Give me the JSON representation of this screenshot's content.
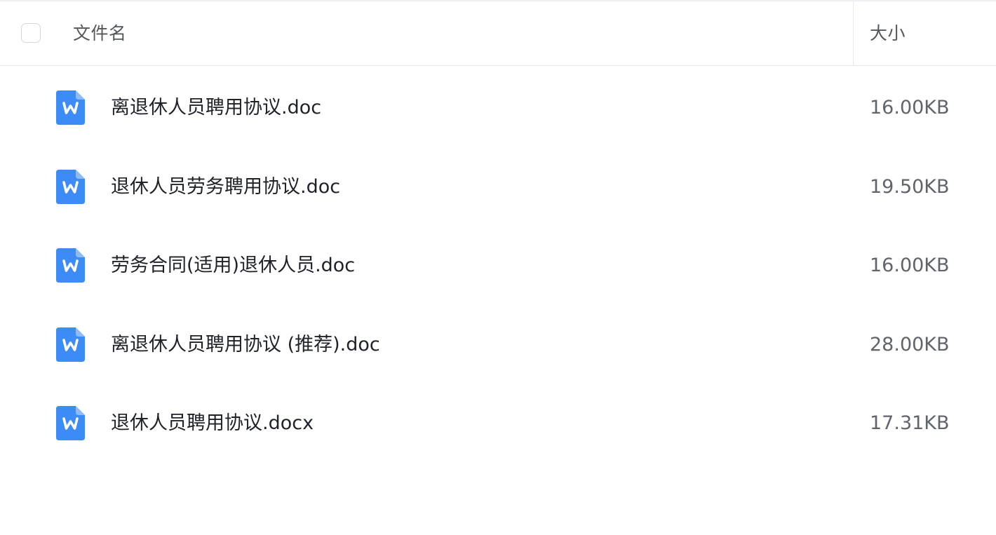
{
  "header": {
    "name_label": "文件名",
    "size_label": "大小"
  },
  "files": [
    {
      "name": "离退休人员聘用协议.doc",
      "size": "16.00KB",
      "icon": "word-doc-icon"
    },
    {
      "name": "退休人员劳务聘用协议.doc",
      "size": "19.50KB",
      "icon": "word-doc-icon"
    },
    {
      "name": "劳务合同(适用)退休人员.doc",
      "size": "16.00KB",
      "icon": "word-doc-icon"
    },
    {
      "name": "离退休人员聘用协议 (推荐).doc",
      "size": "28.00KB",
      "icon": "word-doc-icon"
    },
    {
      "name": "退休人员聘用协议.docx",
      "size": "17.31KB",
      "icon": "word-doc-icon"
    }
  ],
  "colors": {
    "icon_blue": "#3d8bf7",
    "icon_blue_dark": "#2f76e6",
    "text_primary": "#1f2329",
    "text_secondary": "#60646b"
  }
}
